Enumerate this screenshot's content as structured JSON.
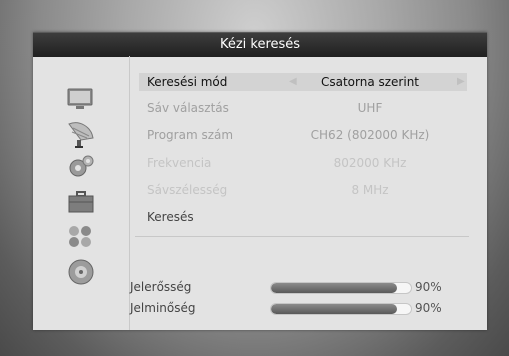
{
  "window": {
    "title": "Kézi keresés"
  },
  "sidebar": {
    "icons": [
      "tv-icon",
      "satellite-dish-icon",
      "settings-gear-icon",
      "toolbox-icon",
      "games-icon",
      "media-disc-icon"
    ]
  },
  "settings": {
    "mode": {
      "label": "Keresési mód",
      "value": "Csatorna szerint"
    },
    "band": {
      "label": "Sáv választás",
      "value": "UHF"
    },
    "program": {
      "label": "Program szám",
      "value": "CH62 (802000 KHz)"
    },
    "frequency": {
      "label": "Frekvencia",
      "value": "802000 KHz"
    },
    "bandwidth": {
      "label": "Sávszélesség",
      "value": "8 MHz"
    },
    "search": {
      "label": "Keresés"
    }
  },
  "signal": {
    "strength": {
      "label": "Jelerősség",
      "percent_text": "90%",
      "fill_percent": 90
    },
    "quality": {
      "label": "Jelminőség",
      "percent_text": "90%",
      "fill_percent": 90
    }
  }
}
